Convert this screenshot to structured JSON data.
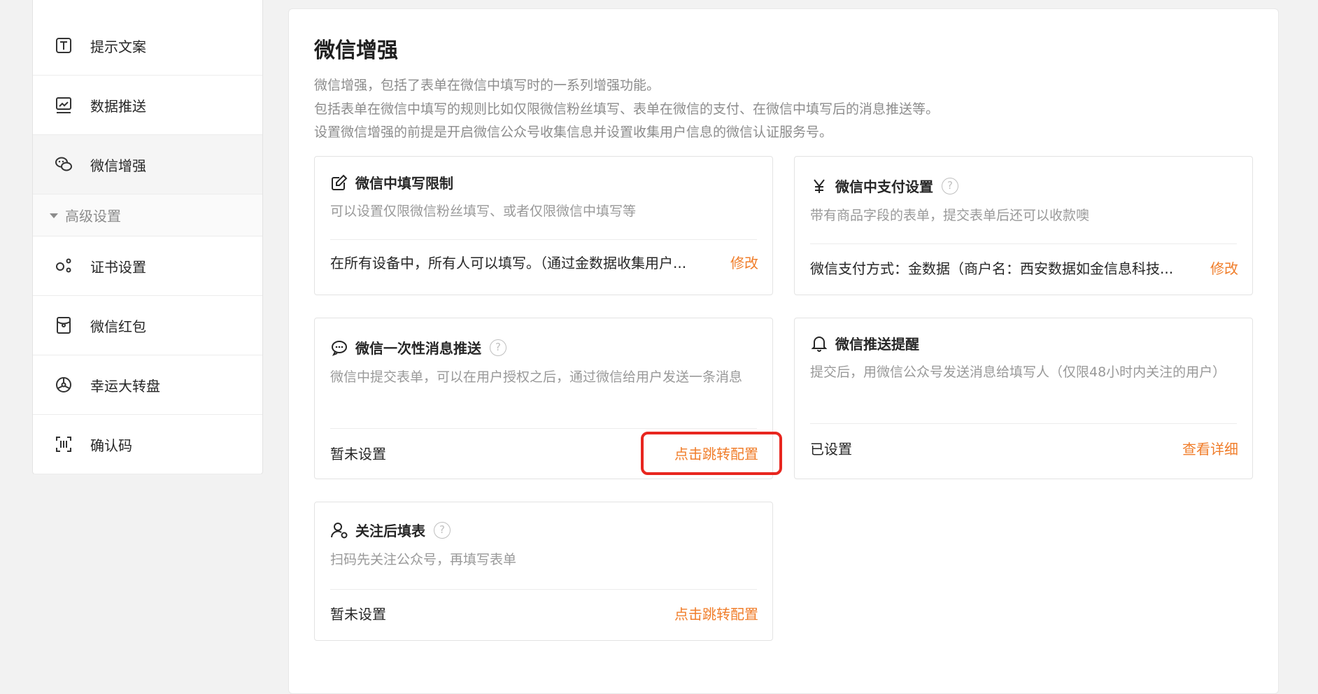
{
  "sidebar": {
    "items": [
      {
        "label": "提示文案",
        "icon": "text-icon"
      },
      {
        "label": "数据推送",
        "icon": "chart-icon"
      },
      {
        "label": "微信增强",
        "icon": "wechat-icon",
        "active": true
      }
    ],
    "group": {
      "label": "高级设置"
    },
    "group_items": [
      {
        "label": "证书设置",
        "icon": "certificate-icon"
      },
      {
        "label": "微信红包",
        "icon": "red-envelope-icon"
      },
      {
        "label": "幸运大转盘",
        "icon": "wheel-icon"
      },
      {
        "label": "确认码",
        "icon": "scan-code-icon"
      }
    ]
  },
  "main": {
    "title": "微信增强",
    "desc_lines": [
      "微信增强，包括了表单在微信中填写时的一系列增强功能。",
      "包括表单在微信中填写的规则比如仅限微信粉丝填写、表单在微信的支付、在微信中填写后的消息推送等。",
      "设置微信增强的前提是开启微信公众号收集信息并设置收集用户信息的微信认证服务号。"
    ],
    "cards": [
      {
        "title": "微信中填写限制",
        "icon": "edit-icon",
        "desc": "可以设置仅限微信粉丝填写、或者仅限微信中填写等",
        "status": "在所有设备中，所有人可以填写。（通过金数据收集用户...",
        "action": "修改"
      },
      {
        "title": "微信中支付设置",
        "icon": "yen-icon",
        "desc": "带有商品字段的表单，提交表单后还可以收款噢",
        "status": "微信支付方式：金数据（商户名：西安数据如金信息科技...",
        "action": "修改"
      },
      {
        "title": "微信一次性消息推送",
        "icon": "message-icon",
        "desc": "微信中提交表单，可以在用户授权之后，通过微信给用户发送一条消息",
        "status": "暂未设置",
        "action": "点击跳转配置"
      },
      {
        "title": "微信推送提醒",
        "icon": "bell-icon",
        "desc": "提交后，用微信公众号发送消息给填写人（仅限48小时内关注的用户）",
        "status": "已设置",
        "action": "查看详细"
      },
      {
        "title": "关注后填表",
        "icon": "user-follow-icon",
        "desc": "扫码先关注公众号，再填写表单",
        "status": "暂未设置",
        "action": "点击跳转配置"
      }
    ],
    "help_glyph": "?"
  },
  "colors": {
    "accent": "#f07d2a",
    "highlight": "#e8261f"
  }
}
